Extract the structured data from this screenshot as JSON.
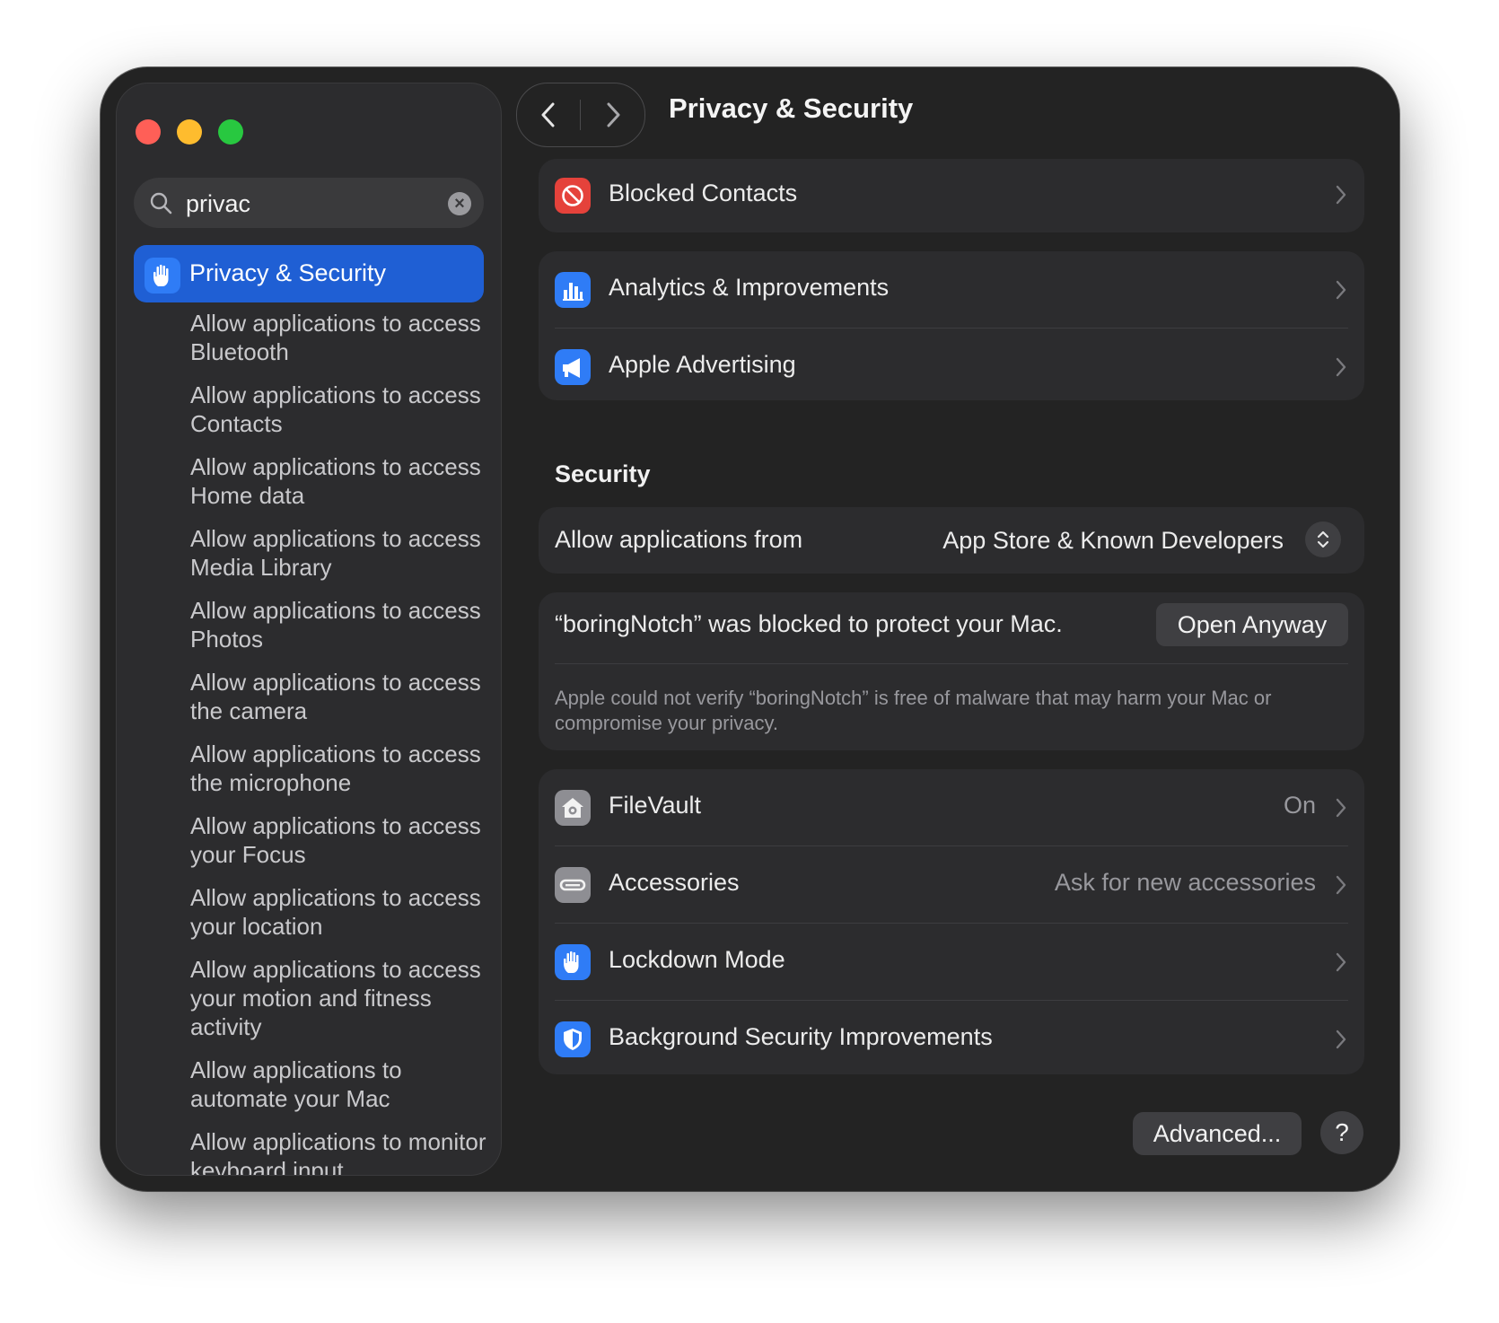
{
  "window": {
    "title": "Privacy & Security"
  },
  "search": {
    "value": "privac"
  },
  "sidebar": {
    "selected": {
      "label": "Privacy & Security",
      "icon": "hand-raised-icon"
    },
    "items": [
      "Allow applications to access Bluetooth",
      "Allow applications to access Contacts",
      "Allow applications to access Home data",
      "Allow applications to access Media Library",
      "Allow applications to access Photos",
      "Allow applications to access the camera",
      "Allow applications to access the microphone",
      "Allow applications to access your Focus",
      "Allow applications to access your location",
      "Allow applications to access your motion and fitness activity",
      "Allow applications to automate your Mac",
      "Allow applications to monitor keyboard input"
    ]
  },
  "main": {
    "blocked_contacts": {
      "label": "Blocked Contacts",
      "icon": "blocked-icon"
    },
    "analytics": {
      "label": "Analytics & Improvements",
      "icon": "analytics-icon"
    },
    "advertising": {
      "label": "Apple Advertising",
      "icon": "megaphone-icon"
    },
    "security": {
      "title": "Security",
      "allow_label": "Allow applications from",
      "allow_value": "App Store & Known Developers",
      "blocked_message": "“boringNotch” was blocked to protect your Mac.",
      "open_anyway": "Open Anyway",
      "blocked_note": "Apple could not verify “boringNotch” is free of malware that may harm your Mac or compromise your privacy.",
      "filevault": {
        "label": "FileVault",
        "value": "On",
        "icon": "filevault-house-icon"
      },
      "accessories": {
        "label": "Accessories",
        "value": "Ask for new accessories",
        "icon": "usb-connector-icon"
      },
      "lockdown": {
        "label": "Lockdown Mode",
        "icon": "hand-raised-icon"
      },
      "background": {
        "label": "Background Security Improvements",
        "icon": "shield-icon"
      }
    },
    "advanced_button": "Advanced...",
    "help_button": "?"
  },
  "colors": {
    "accent": "#1f5fd4",
    "window_bg": "#232323",
    "card_bg": "#2c2c2e",
    "blocked_icon": "#e5423b",
    "blue_icon": "#2f7cf6",
    "gray_icon": "#8e8e93"
  }
}
